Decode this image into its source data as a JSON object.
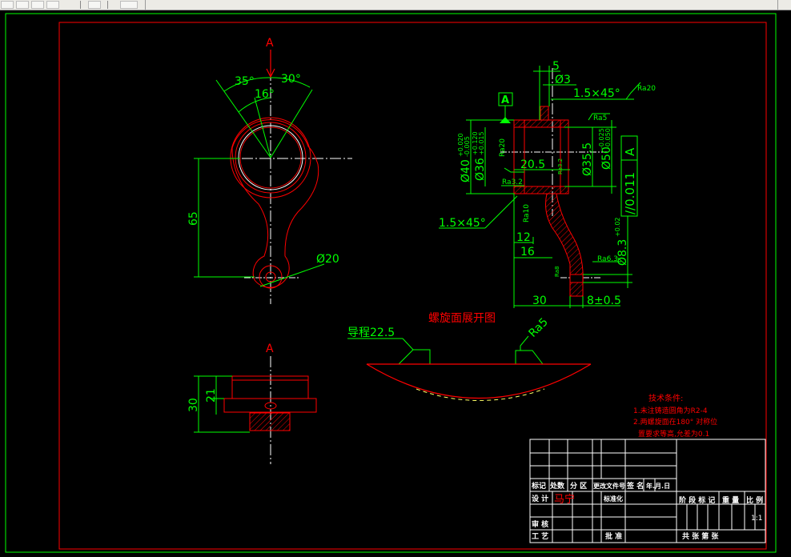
{
  "toolbar": {
    "buttons": [
      "new-file-icon",
      "open-folder-icon",
      "save-icon",
      "print-icon",
      "cut-icon",
      "paint-icon"
    ]
  },
  "view_a": {
    "section_marker": "A",
    "angle_35": "35°",
    "angle_30": "30°",
    "angle_16": "16°",
    "dim_65": "65",
    "dim_d20": "Ø20"
  },
  "view_b": {
    "dim_5": "5",
    "dim_d3": "Ø3",
    "chamfer_top": "1.5×45°",
    "rough_ra20_top": "Ra20",
    "datum_label": "A",
    "rough_ra5": "Ra5",
    "dim_d40": "Ø40",
    "tol_d40_upper": "+0.020",
    "tol_d40_lower": "-0.005",
    "dim_d36": "Ø36",
    "tol_d36_upper": "+0.120",
    "tol_d36_lower": "+0.015",
    "rough_ra20_side": "Ra20",
    "dim_205": "20.5",
    "rough_ra32_small": "Ra3.2",
    "rough_ra32": "Ra3.2",
    "dim_d355": "Ø35.5",
    "dim_d50": "Ø50",
    "tol_d50_upper": "-0.025",
    "tol_d50_lower": "-0.050",
    "parallel_tol": "//0.011",
    "parallel_datum": "A",
    "chamfer_bottom": "1.5×45°",
    "rough_ra10": "Ra10",
    "dim_12": "12",
    "dim_16": "16",
    "dim_d83": "Ø8.3",
    "tol_d83": "+0.02",
    "rough_ra63": "Ra6.3",
    "rough_ra8": "Ra8",
    "dim_30": "30",
    "dim_8": "8±0.5"
  },
  "view_c": {
    "section_marker": "A",
    "dim_30": "30",
    "dim_21": "21"
  },
  "view_d": {
    "title": "螺旋面展开图",
    "lead": "导程22.5",
    "rough_ra5": "Ra5"
  },
  "notes": {
    "title": "技术条件:",
    "line1": "1.未注铸造圆角为R2-4",
    "line2": "2.两螺旋面在180° 对称位",
    "line3": "置要求等高,允差为0.1"
  },
  "title_block": {
    "h_mark": "标记",
    "h_count": "处数",
    "h_zone": "分 区",
    "h_docno": "更改文件号",
    "h_sign": "签 名",
    "h_date": "年.月.日",
    "r_design": "设 计",
    "designer": "马宁",
    "r_std": "标准化",
    "r_review": "审 核",
    "r_process": "工 艺",
    "r_approve": "批 准",
    "h_stage": "阶 段 标 记",
    "h_weight": "重 量",
    "h_scale": "比 例",
    "scale_value": "1:1",
    "sheets": "共     张  第     张"
  },
  "colors": {
    "background": "#000000",
    "border": "#ff0000",
    "frame": "#00ff00",
    "dimension": "#00ff00",
    "part": "#ff0000",
    "hatch": "#ff0000",
    "centerline": "#ffffff",
    "text": "#ffffff",
    "notes": "#ff0000"
  }
}
